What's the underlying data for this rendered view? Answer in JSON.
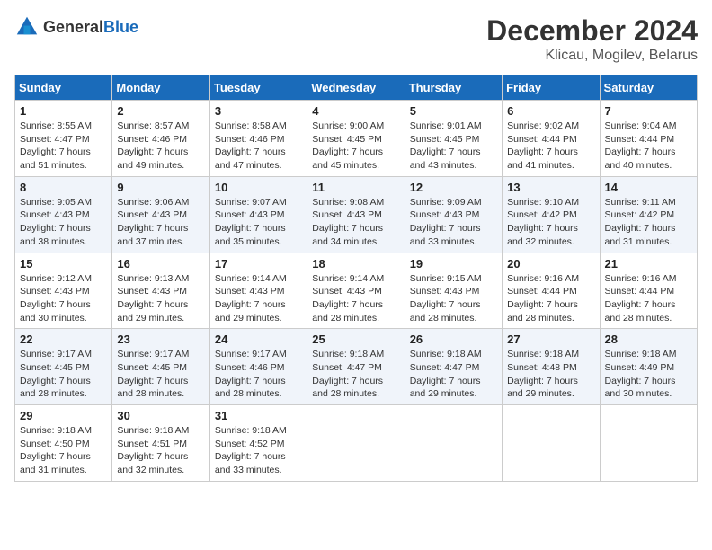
{
  "logo": {
    "general": "General",
    "blue": "Blue"
  },
  "title": "December 2024",
  "subtitle": "Klicau, Mogilev, Belarus",
  "days_header": [
    "Sunday",
    "Monday",
    "Tuesday",
    "Wednesday",
    "Thursday",
    "Friday",
    "Saturday"
  ],
  "weeks": [
    [
      {
        "num": "1",
        "sunrise": "Sunrise: 8:55 AM",
        "sunset": "Sunset: 4:47 PM",
        "daylight": "Daylight: 7 hours and 51 minutes."
      },
      {
        "num": "2",
        "sunrise": "Sunrise: 8:57 AM",
        "sunset": "Sunset: 4:46 PM",
        "daylight": "Daylight: 7 hours and 49 minutes."
      },
      {
        "num": "3",
        "sunrise": "Sunrise: 8:58 AM",
        "sunset": "Sunset: 4:46 PM",
        "daylight": "Daylight: 7 hours and 47 minutes."
      },
      {
        "num": "4",
        "sunrise": "Sunrise: 9:00 AM",
        "sunset": "Sunset: 4:45 PM",
        "daylight": "Daylight: 7 hours and 45 minutes."
      },
      {
        "num": "5",
        "sunrise": "Sunrise: 9:01 AM",
        "sunset": "Sunset: 4:45 PM",
        "daylight": "Daylight: 7 hours and 43 minutes."
      },
      {
        "num": "6",
        "sunrise": "Sunrise: 9:02 AM",
        "sunset": "Sunset: 4:44 PM",
        "daylight": "Daylight: 7 hours and 41 minutes."
      },
      {
        "num": "7",
        "sunrise": "Sunrise: 9:04 AM",
        "sunset": "Sunset: 4:44 PM",
        "daylight": "Daylight: 7 hours and 40 minutes."
      }
    ],
    [
      {
        "num": "8",
        "sunrise": "Sunrise: 9:05 AM",
        "sunset": "Sunset: 4:43 PM",
        "daylight": "Daylight: 7 hours and 38 minutes."
      },
      {
        "num": "9",
        "sunrise": "Sunrise: 9:06 AM",
        "sunset": "Sunset: 4:43 PM",
        "daylight": "Daylight: 7 hours and 37 minutes."
      },
      {
        "num": "10",
        "sunrise": "Sunrise: 9:07 AM",
        "sunset": "Sunset: 4:43 PM",
        "daylight": "Daylight: 7 hours and 35 minutes."
      },
      {
        "num": "11",
        "sunrise": "Sunrise: 9:08 AM",
        "sunset": "Sunset: 4:43 PM",
        "daylight": "Daylight: 7 hours and 34 minutes."
      },
      {
        "num": "12",
        "sunrise": "Sunrise: 9:09 AM",
        "sunset": "Sunset: 4:43 PM",
        "daylight": "Daylight: 7 hours and 33 minutes."
      },
      {
        "num": "13",
        "sunrise": "Sunrise: 9:10 AM",
        "sunset": "Sunset: 4:42 PM",
        "daylight": "Daylight: 7 hours and 32 minutes."
      },
      {
        "num": "14",
        "sunrise": "Sunrise: 9:11 AM",
        "sunset": "Sunset: 4:42 PM",
        "daylight": "Daylight: 7 hours and 31 minutes."
      }
    ],
    [
      {
        "num": "15",
        "sunrise": "Sunrise: 9:12 AM",
        "sunset": "Sunset: 4:43 PM",
        "daylight": "Daylight: 7 hours and 30 minutes."
      },
      {
        "num": "16",
        "sunrise": "Sunrise: 9:13 AM",
        "sunset": "Sunset: 4:43 PM",
        "daylight": "Daylight: 7 hours and 29 minutes."
      },
      {
        "num": "17",
        "sunrise": "Sunrise: 9:14 AM",
        "sunset": "Sunset: 4:43 PM",
        "daylight": "Daylight: 7 hours and 29 minutes."
      },
      {
        "num": "18",
        "sunrise": "Sunrise: 9:14 AM",
        "sunset": "Sunset: 4:43 PM",
        "daylight": "Daylight: 7 hours and 28 minutes."
      },
      {
        "num": "19",
        "sunrise": "Sunrise: 9:15 AM",
        "sunset": "Sunset: 4:43 PM",
        "daylight": "Daylight: 7 hours and 28 minutes."
      },
      {
        "num": "20",
        "sunrise": "Sunrise: 9:16 AM",
        "sunset": "Sunset: 4:44 PM",
        "daylight": "Daylight: 7 hours and 28 minutes."
      },
      {
        "num": "21",
        "sunrise": "Sunrise: 9:16 AM",
        "sunset": "Sunset: 4:44 PM",
        "daylight": "Daylight: 7 hours and 28 minutes."
      }
    ],
    [
      {
        "num": "22",
        "sunrise": "Sunrise: 9:17 AM",
        "sunset": "Sunset: 4:45 PM",
        "daylight": "Daylight: 7 hours and 28 minutes."
      },
      {
        "num": "23",
        "sunrise": "Sunrise: 9:17 AM",
        "sunset": "Sunset: 4:45 PM",
        "daylight": "Daylight: 7 hours and 28 minutes."
      },
      {
        "num": "24",
        "sunrise": "Sunrise: 9:17 AM",
        "sunset": "Sunset: 4:46 PM",
        "daylight": "Daylight: 7 hours and 28 minutes."
      },
      {
        "num": "25",
        "sunrise": "Sunrise: 9:18 AM",
        "sunset": "Sunset: 4:47 PM",
        "daylight": "Daylight: 7 hours and 28 minutes."
      },
      {
        "num": "26",
        "sunrise": "Sunrise: 9:18 AM",
        "sunset": "Sunset: 4:47 PM",
        "daylight": "Daylight: 7 hours and 29 minutes."
      },
      {
        "num": "27",
        "sunrise": "Sunrise: 9:18 AM",
        "sunset": "Sunset: 4:48 PM",
        "daylight": "Daylight: 7 hours and 29 minutes."
      },
      {
        "num": "28",
        "sunrise": "Sunrise: 9:18 AM",
        "sunset": "Sunset: 4:49 PM",
        "daylight": "Daylight: 7 hours and 30 minutes."
      }
    ],
    [
      {
        "num": "29",
        "sunrise": "Sunrise: 9:18 AM",
        "sunset": "Sunset: 4:50 PM",
        "daylight": "Daylight: 7 hours and 31 minutes."
      },
      {
        "num": "30",
        "sunrise": "Sunrise: 9:18 AM",
        "sunset": "Sunset: 4:51 PM",
        "daylight": "Daylight: 7 hours and 32 minutes."
      },
      {
        "num": "31",
        "sunrise": "Sunrise: 9:18 AM",
        "sunset": "Sunset: 4:52 PM",
        "daylight": "Daylight: 7 hours and 33 minutes."
      },
      null,
      null,
      null,
      null
    ]
  ]
}
